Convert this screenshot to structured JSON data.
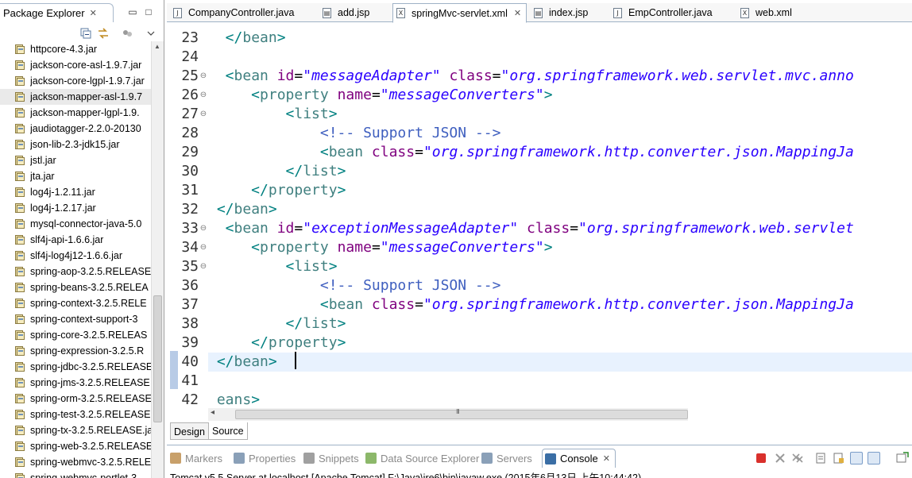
{
  "package_explorer": {
    "title": "Package Explorer",
    "close_glyph": "✕",
    "minimize_glyph": "▭",
    "maximize_glyph": "□",
    "items": [
      {
        "label": "httpcore-4.3.jar"
      },
      {
        "label": "jackson-core-asl-1.9.7.jar"
      },
      {
        "label": "jackson-core-lgpl-1.9.7.jar"
      },
      {
        "label": "jackson-mapper-asl-1.9.7",
        "selected": true
      },
      {
        "label": "jackson-mapper-lgpl-1.9."
      },
      {
        "label": "jaudiotagger-2.2.0-20130"
      },
      {
        "label": "json-lib-2.3-jdk15.jar"
      },
      {
        "label": "jstl.jar"
      },
      {
        "label": "jta.jar"
      },
      {
        "label": "log4j-1.2.11.jar"
      },
      {
        "label": "log4j-1.2.17.jar"
      },
      {
        "label": "mysql-connector-java-5.0"
      },
      {
        "label": "slf4j-api-1.6.6.jar"
      },
      {
        "label": "slf4j-log4j12-1.6.6.jar"
      },
      {
        "label": "spring-aop-3.2.5.RELEASE"
      },
      {
        "label": "spring-beans-3.2.5.RELEA"
      },
      {
        "label": "spring-context-3.2.5.RELE"
      },
      {
        "label": "spring-context-support-3"
      },
      {
        "label": "spring-core-3.2.5.RELEAS"
      },
      {
        "label": "spring-expression-3.2.5.R"
      },
      {
        "label": "spring-jdbc-3.2.5.RELEASE"
      },
      {
        "label": "spring-jms-3.2.5.RELEASE"
      },
      {
        "label": "spring-orm-3.2.5.RELEASE"
      },
      {
        "label": "spring-test-3.2.5.RELEASE"
      },
      {
        "label": "spring-tx-3.2.5.RELEASE.ja"
      },
      {
        "label": "spring-web-3.2.5.RELEASE"
      },
      {
        "label": "spring-webmvc-3.2.5.RELE"
      },
      {
        "label": "spring-webmvc-portlet-3"
      }
    ]
  },
  "editor": {
    "tabs": [
      {
        "label": "CompanyController.java",
        "icon": "J",
        "active": false
      },
      {
        "label": "add.jsp",
        "icon": "▤",
        "active": false
      },
      {
        "label": "springMvc-servlet.xml",
        "icon": "X",
        "active": true,
        "close": "✕"
      },
      {
        "label": "index.jsp",
        "icon": "▤",
        "active": false
      },
      {
        "label": "EmpController.java",
        "icon": "J",
        "active": false
      },
      {
        "label": "web.xml",
        "icon": "X",
        "active": false
      }
    ],
    "lines": [
      {
        "num": "23",
        "fold": "",
        "tokens": [
          [
            "br",
            "  </"
          ],
          [
            "tag",
            "bean"
          ],
          [
            "br",
            ">"
          ]
        ]
      },
      {
        "num": "24",
        "fold": "",
        "tokens": []
      },
      {
        "num": "25",
        "fold": "⊖",
        "tokens": [
          [
            "br",
            "  <"
          ],
          [
            "tag",
            "bean "
          ],
          [
            "at",
            "id"
          ],
          [
            "txt",
            "="
          ],
          [
            "val",
            "\"messageAdapter\""
          ],
          [
            "txt",
            " "
          ],
          [
            "at",
            "class"
          ],
          [
            "txt",
            "="
          ],
          [
            "val",
            "\"org.springframework.web.servlet.mvc.anno"
          ]
        ]
      },
      {
        "num": "26",
        "fold": "⊖",
        "tokens": [
          [
            "br",
            "     <"
          ],
          [
            "tag",
            "property "
          ],
          [
            "at",
            "name"
          ],
          [
            "txt",
            "="
          ],
          [
            "val",
            "\"messageConverters\""
          ],
          [
            "br",
            ">"
          ]
        ]
      },
      {
        "num": "27",
        "fold": "⊖",
        "tokens": [
          [
            "br",
            "         <"
          ],
          [
            "tag",
            "list"
          ],
          [
            "br",
            ">"
          ]
        ]
      },
      {
        "num": "28",
        "fold": "",
        "tokens": [
          [
            "cm",
            "             <!-- Support JSON -->"
          ]
        ]
      },
      {
        "num": "29",
        "fold": "",
        "tokens": [
          [
            "br",
            "             <"
          ],
          [
            "tag",
            "bean "
          ],
          [
            "at",
            "class"
          ],
          [
            "txt",
            "="
          ],
          [
            "val",
            "\"org.springframework.http.converter.json.MappingJa"
          ]
        ]
      },
      {
        "num": "30",
        "fold": "",
        "tokens": [
          [
            "br",
            "         </"
          ],
          [
            "tag",
            "list"
          ],
          [
            "br",
            ">"
          ]
        ]
      },
      {
        "num": "31",
        "fold": "",
        "tokens": [
          [
            "br",
            "     </"
          ],
          [
            "tag",
            "property"
          ],
          [
            "br",
            ">"
          ]
        ]
      },
      {
        "num": "32",
        "fold": "",
        "tokens": [
          [
            "br",
            " </"
          ],
          [
            "tag",
            "bean"
          ],
          [
            "br",
            ">"
          ]
        ]
      },
      {
        "num": "33",
        "fold": "⊖",
        "tokens": [
          [
            "br",
            "  <"
          ],
          [
            "tag",
            "bean "
          ],
          [
            "at",
            "id"
          ],
          [
            "txt",
            "="
          ],
          [
            "val",
            "\"exceptionMessageAdapter\""
          ],
          [
            "txt",
            " "
          ],
          [
            "at",
            "class"
          ],
          [
            "txt",
            "="
          ],
          [
            "val",
            "\"org.springframework.web.servlet"
          ]
        ]
      },
      {
        "num": "34",
        "fold": "⊖",
        "tokens": [
          [
            "br",
            "     <"
          ],
          [
            "tag",
            "property "
          ],
          [
            "at",
            "name"
          ],
          [
            "txt",
            "="
          ],
          [
            "val",
            "\"messageConverters\""
          ],
          [
            "br",
            ">"
          ]
        ]
      },
      {
        "num": "35",
        "fold": "⊖",
        "tokens": [
          [
            "br",
            "         <"
          ],
          [
            "tag",
            "list"
          ],
          [
            "br",
            ">"
          ]
        ]
      },
      {
        "num": "36",
        "fold": "",
        "tokens": [
          [
            "cm",
            "             <!-- Support JSON -->"
          ]
        ]
      },
      {
        "num": "37",
        "fold": "",
        "tokens": [
          [
            "br",
            "             <"
          ],
          [
            "tag",
            "bean "
          ],
          [
            "at",
            "class"
          ],
          [
            "txt",
            "="
          ],
          [
            "val",
            "\"org.springframework.http.converter.json.MappingJa"
          ]
        ]
      },
      {
        "num": "38",
        "fold": "",
        "tokens": [
          [
            "br",
            "         </"
          ],
          [
            "tag",
            "list"
          ],
          [
            "br",
            ">"
          ]
        ]
      },
      {
        "num": "39",
        "fold": "",
        "tokens": [
          [
            "br",
            "     </"
          ],
          [
            "tag",
            "property"
          ],
          [
            "br",
            ">"
          ]
        ]
      },
      {
        "num": "40",
        "fold": "",
        "highlight": true,
        "tokens": [
          [
            "br",
            " </"
          ],
          [
            "tag",
            "bean"
          ],
          [
            "br",
            ">"
          ]
        ]
      },
      {
        "num": "41",
        "fold": "",
        "tokens": []
      },
      {
        "num": "42",
        "fold": "",
        "tokens": [
          [
            "tag",
            " eans"
          ],
          [
            "br",
            ">"
          ]
        ]
      }
    ],
    "hscroll_left": "◂",
    "hscroll_grip": "III",
    "design_tab": "Design",
    "source_tab": "Source"
  },
  "bottom": {
    "tabs": [
      {
        "label": "Markers",
        "color": "#c8a06a"
      },
      {
        "label": "Properties",
        "color": "#8aa0b8"
      },
      {
        "label": "Snippets",
        "color": "#a0a0a0"
      },
      {
        "label": "Data Source Explorer",
        "color": "#8cb86a"
      },
      {
        "label": "Servers",
        "color": "#8aa0b8"
      },
      {
        "label": "Console",
        "color": "#3a6ea5",
        "active": true,
        "close": "✕"
      }
    ],
    "console_line": "Tomcat v5.5 Server at localhost [Apache Tomcat] F:\\Java\\jre6\\bin\\javaw.exe (2015年6月13日 上午10:44:42)"
  },
  "colors": {
    "tag": "#3f7f7f",
    "attribute": "#7f007f",
    "value": "#2a00ff",
    "comment": "#3f5fbf",
    "bracket": "#008080",
    "current_line": "#e8f2fe"
  }
}
